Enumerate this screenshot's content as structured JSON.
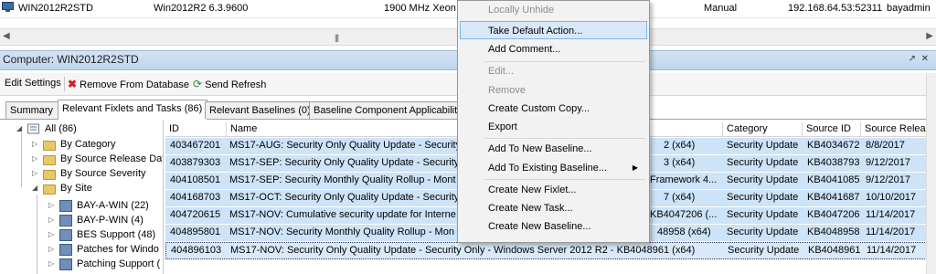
{
  "top_row": {
    "computer": "WIN2012R2STD",
    "os": "Win2012R2 6.3.9600",
    "cpu": "1900 MHz Xeon",
    "lock_mode": "Manual",
    "address": "192.168.64.53:52311",
    "user": "bayadmin"
  },
  "title_bar": {
    "title": "Computer: WIN2012R2STD"
  },
  "toolbar": {
    "edit_settings": "Edit Settings",
    "remove_from_database": "Remove From Database",
    "send_refresh": "Send Refresh"
  },
  "tabs": [
    {
      "label": "Summary"
    },
    {
      "label": "Relevant Fixlets and Tasks (86)"
    },
    {
      "label": "Relevant Baselines (0)"
    },
    {
      "label": "Baseline Component Applicability"
    }
  ],
  "tree": {
    "items": [
      {
        "label": "All (86)"
      },
      {
        "label": "By Category"
      },
      {
        "label": "By Source Release Dat"
      },
      {
        "label": "By Source Severity"
      },
      {
        "label": "By Site"
      },
      {
        "label": "BAY-A-WIN (22)"
      },
      {
        "label": "BAY-P-WIN (4)"
      },
      {
        "label": "BES Support (48)"
      },
      {
        "label": "Patches for Windo"
      },
      {
        "label": "Patching Support ("
      }
    ]
  },
  "grid": {
    "columns": [
      "ID",
      "Name",
      "Category",
      "Source ID",
      "Source Release"
    ],
    "rows": [
      {
        "id": "403467201",
        "name": "MS17-AUG: Security Only Quality Update - Security",
        "name_tail": "2 (x64)",
        "category": "Security Update",
        "source_id": "KB4034672",
        "release": "8/8/2017"
      },
      {
        "id": "403879303",
        "name": "MS17-SEP: Security Only Quality Update - Security",
        "name_tail": "3 (x64)",
        "category": "Security Update",
        "source_id": "KB4038793",
        "release": "9/12/2017"
      },
      {
        "id": "404108501",
        "name": "MS17-SEP: Security Monthly Quality Rollup - Mont",
        "name_tail": "Framework 4...",
        "category": "Security Update",
        "source_id": "KB4041085",
        "release": "9/12/2017"
      },
      {
        "id": "404168703",
        "name": "MS17-OCT: Security Only Quality Update - Security",
        "name_tail": "7 (x64)",
        "category": "Security Update",
        "source_id": "KB4041687",
        "release": "10/10/2017"
      },
      {
        "id": "404720615",
        "name": "MS17-NOV: Cumulative security update for Interne",
        "name_tail": "KB4047206 (...",
        "category": "Security Update",
        "source_id": "KB4047206",
        "release": "11/14/2017"
      },
      {
        "id": "404895801",
        "name": "MS17-NOV: Security Monthly Quality Rollup - Mon",
        "name_tail": "48958 (x64)",
        "category": "Security Update",
        "source_id": "KB4048958",
        "release": "11/14/2017"
      },
      {
        "id": "404896103",
        "name": "MS17-NOV: Security Only Quality Update - Security Only - Windows Server 2012 R2 - KB4048961 (x64)",
        "name_tail": "",
        "category": "Security Update",
        "source_id": "KB4048961",
        "release": "11/14/2017"
      }
    ]
  },
  "context_menu": {
    "locally_unhide": "Locally Unhide",
    "take_default_action": "Take Default Action...",
    "add_comment": "Add Comment...",
    "edit": "Edit...",
    "remove": "Remove",
    "create_custom_copy": "Create Custom Copy...",
    "export": "Export",
    "add_to_new_baseline": "Add To New Baseline...",
    "add_to_existing_baseline": "Add To Existing Baseline...",
    "create_new_fixlet": "Create New Fixlet...",
    "create_new_task": "Create New Task...",
    "create_new_baseline": "Create New Baseline..."
  },
  "colors": {
    "selection": "#cde3f7",
    "title_bar": "#c8dcf2",
    "menu_hover": "#d9e8f9"
  }
}
